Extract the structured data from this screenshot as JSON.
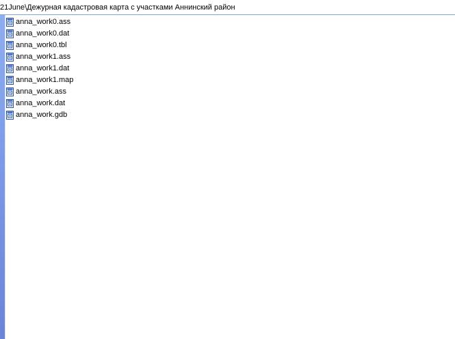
{
  "address": {
    "path": "21June\\Дежурная кадастровая карта с участками Аннинский район"
  },
  "files": [
    {
      "name": "anna_work0.ass",
      "icon": "generic-file-icon"
    },
    {
      "name": "anna_work0.dat",
      "icon": "generic-file-icon"
    },
    {
      "name": "anna_work0.tbl",
      "icon": "generic-file-icon"
    },
    {
      "name": "anna_work1.ass",
      "icon": "generic-file-icon"
    },
    {
      "name": "anna_work1.dat",
      "icon": "generic-file-icon"
    },
    {
      "name": "anna_work1.map",
      "icon": "generic-file-icon"
    },
    {
      "name": "anna_work.ass",
      "icon": "generic-file-icon"
    },
    {
      "name": "anna_work.dat",
      "icon": "generic-file-icon"
    },
    {
      "name": "anna_work.gdb",
      "icon": "generic-file-icon"
    }
  ],
  "colors": {
    "left_pane": "#7a98e6",
    "address_border": "#7aa7d4",
    "icon_blue": "#1f4fae"
  }
}
